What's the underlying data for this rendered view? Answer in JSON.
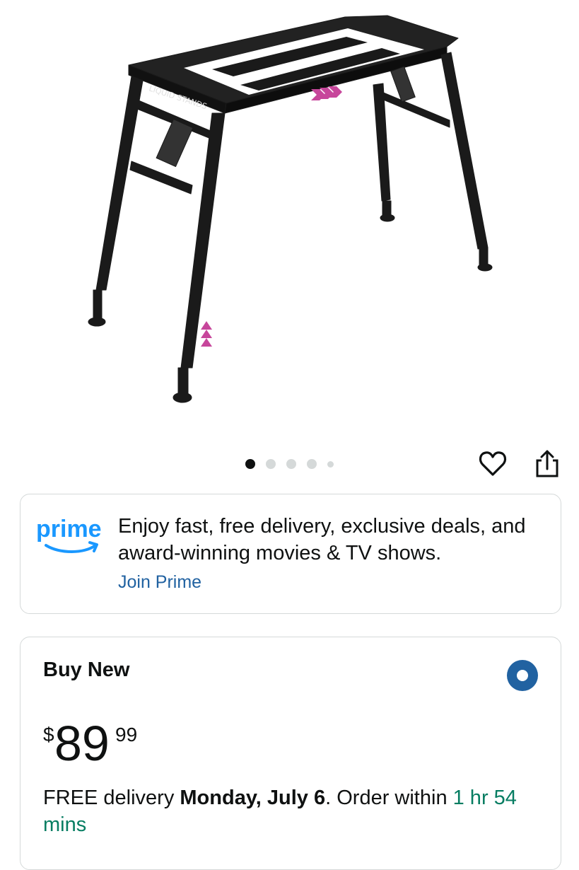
{
  "product": {
    "image_alt": "Black adjustable keyboard stand",
    "brand_label": "LIQUID STANDS"
  },
  "gallery": {
    "image_count": 5,
    "active_index": 0
  },
  "actions": {
    "favorite_icon": "heart-icon",
    "share_icon": "share-icon"
  },
  "prime": {
    "logo_text": "prime",
    "message": "Enjoy fast, free delivery, exclusive deals, and award-winning movies & TV shows.",
    "join_label": "Join Prime"
  },
  "buy_new": {
    "title": "Buy New",
    "selected": true,
    "price": {
      "symbol": "$",
      "whole": "89",
      "fraction": "99"
    },
    "delivery": {
      "prefix": "FREE delivery ",
      "date": "Monday, July 6",
      "middle": ". Order within ",
      "countdown": "1 hr 54 mins"
    }
  },
  "colors": {
    "link": "#2162a1",
    "prime_blue": "#1a98ff",
    "green": "#067d62",
    "accent_pink": "#c7469b"
  }
}
